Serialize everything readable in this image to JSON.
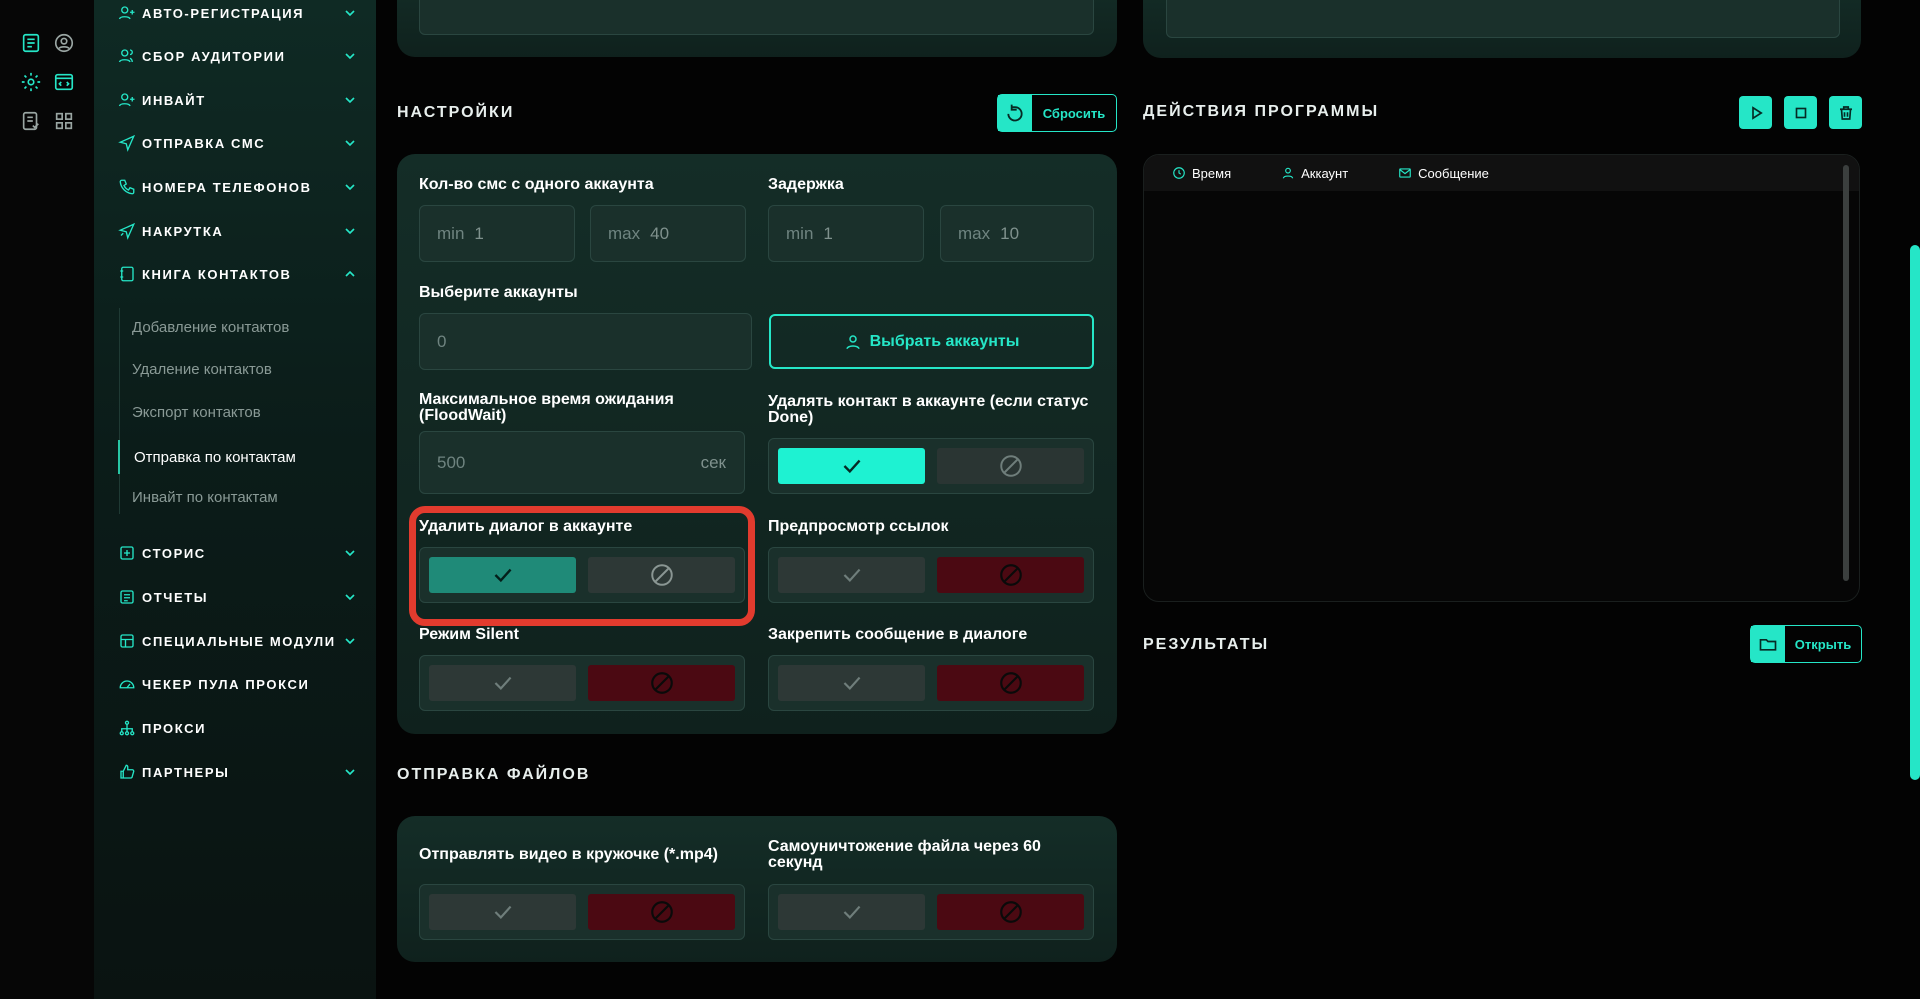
{
  "colors": {
    "accent": "#25e6c7",
    "on_teal": "#1f8a78",
    "on_cyan": "#1ef2d2",
    "off_red": "#4b0912",
    "highlight": "#e23b2e"
  },
  "rail": {
    "icons": [
      "list-icon",
      "user-circle-icon",
      "gear-icon",
      "code-window-icon",
      "document-check-icon",
      "apps-icon"
    ]
  },
  "sidebar": {
    "items": [
      {
        "label": "АВТО-РЕГИСТРАЦИЯ",
        "icon": "user-plus-icon",
        "chevron": "down"
      },
      {
        "label": "СБОР АУДИТОРИИ",
        "icon": "users-icon",
        "chevron": "down"
      },
      {
        "label": "ИНВАЙТ",
        "icon": "user-add-icon",
        "chevron": "down"
      },
      {
        "label": "ОТПРАВКА СМС",
        "icon": "send-icon",
        "chevron": "down"
      },
      {
        "label": "НОМЕРА ТЕЛЕФОНОВ",
        "icon": "phone-icon",
        "chevron": "down"
      },
      {
        "label": "НАКРУТКА",
        "icon": "boost-icon",
        "chevron": "down"
      },
      {
        "label": "КНИГА КОНТАКТОВ",
        "icon": "contacts-book-icon",
        "chevron": "up"
      },
      {
        "label": "СТОРИС",
        "icon": "story-plus-icon",
        "chevron": "down"
      },
      {
        "label": "ОТЧЕТЫ",
        "icon": "report-icon",
        "chevron": "down"
      },
      {
        "label": "СПЕЦИАЛЬНЫЕ МОДУЛИ",
        "icon": "modules-icon",
        "chevron": "down"
      },
      {
        "label": "ЧЕКЕР ПУЛА ПРОКСИ",
        "icon": "gauge-icon",
        "chevron": "none"
      },
      {
        "label": "ПРОКСИ",
        "icon": "network-icon",
        "chevron": "none"
      },
      {
        "label": "ПАРТНЕРЫ",
        "icon": "thumbs-up-icon",
        "chevron": "down"
      }
    ],
    "subitems": [
      {
        "label": "Добавление контактов",
        "active": false
      },
      {
        "label": "Удаление контактов",
        "active": false
      },
      {
        "label": "Экспорт контактов",
        "active": false
      },
      {
        "label": "Отправка по контактам",
        "active": true
      },
      {
        "label": "Инвайт по контактам",
        "active": false
      }
    ]
  },
  "settings": {
    "title": "НАСТРОЙКИ",
    "reset_label": "Сбросить",
    "sms_per_account": {
      "label": "Кол-во смс с одного аккаунта",
      "min_prefix": "min",
      "min_value": "1",
      "max_prefix": "max",
      "max_value": "40"
    },
    "delay": {
      "label": "Задержка",
      "min_prefix": "min",
      "min_value": "1",
      "max_prefix": "max",
      "max_value": "10"
    },
    "select_accounts": {
      "label": "Выберите аккаунты",
      "value": "0",
      "button": "Выбрать аккаунты"
    },
    "flood_wait": {
      "label": "Максимальное время ожидания (FloodWait)",
      "value": "500",
      "suffix": "сек"
    },
    "delete_contact": {
      "label": "Удалять контакт в аккаунте (если статус Done)",
      "enabled": true
    },
    "delete_dialog": {
      "label": "Удалить диалог в аккаунте",
      "enabled": true
    },
    "link_preview": {
      "label": "Предпросмотр ссылок",
      "enabled": false
    },
    "silent_mode": {
      "label": "Режим Silent",
      "enabled": false
    },
    "pin_message": {
      "label": "Закрепить сообщение в диалоге",
      "enabled": false
    }
  },
  "file_sending": {
    "title": "ОТПРАВКА ФАЙЛОВ",
    "video_circle": {
      "label": "Отправлять видео в кружочке (*.mp4)",
      "enabled": false
    },
    "self_destruct": {
      "label": "Самоуничтожение файла через 60 секунд",
      "enabled": false
    }
  },
  "program_actions": {
    "title": "ДЕЙСТВИЯ ПРОГРАММЫ",
    "columns": [
      "Время",
      "Аккаунт",
      "Сообщение"
    ]
  },
  "results": {
    "title": "РЕЗУЛЬТАТЫ",
    "open_label": "Открыть"
  }
}
